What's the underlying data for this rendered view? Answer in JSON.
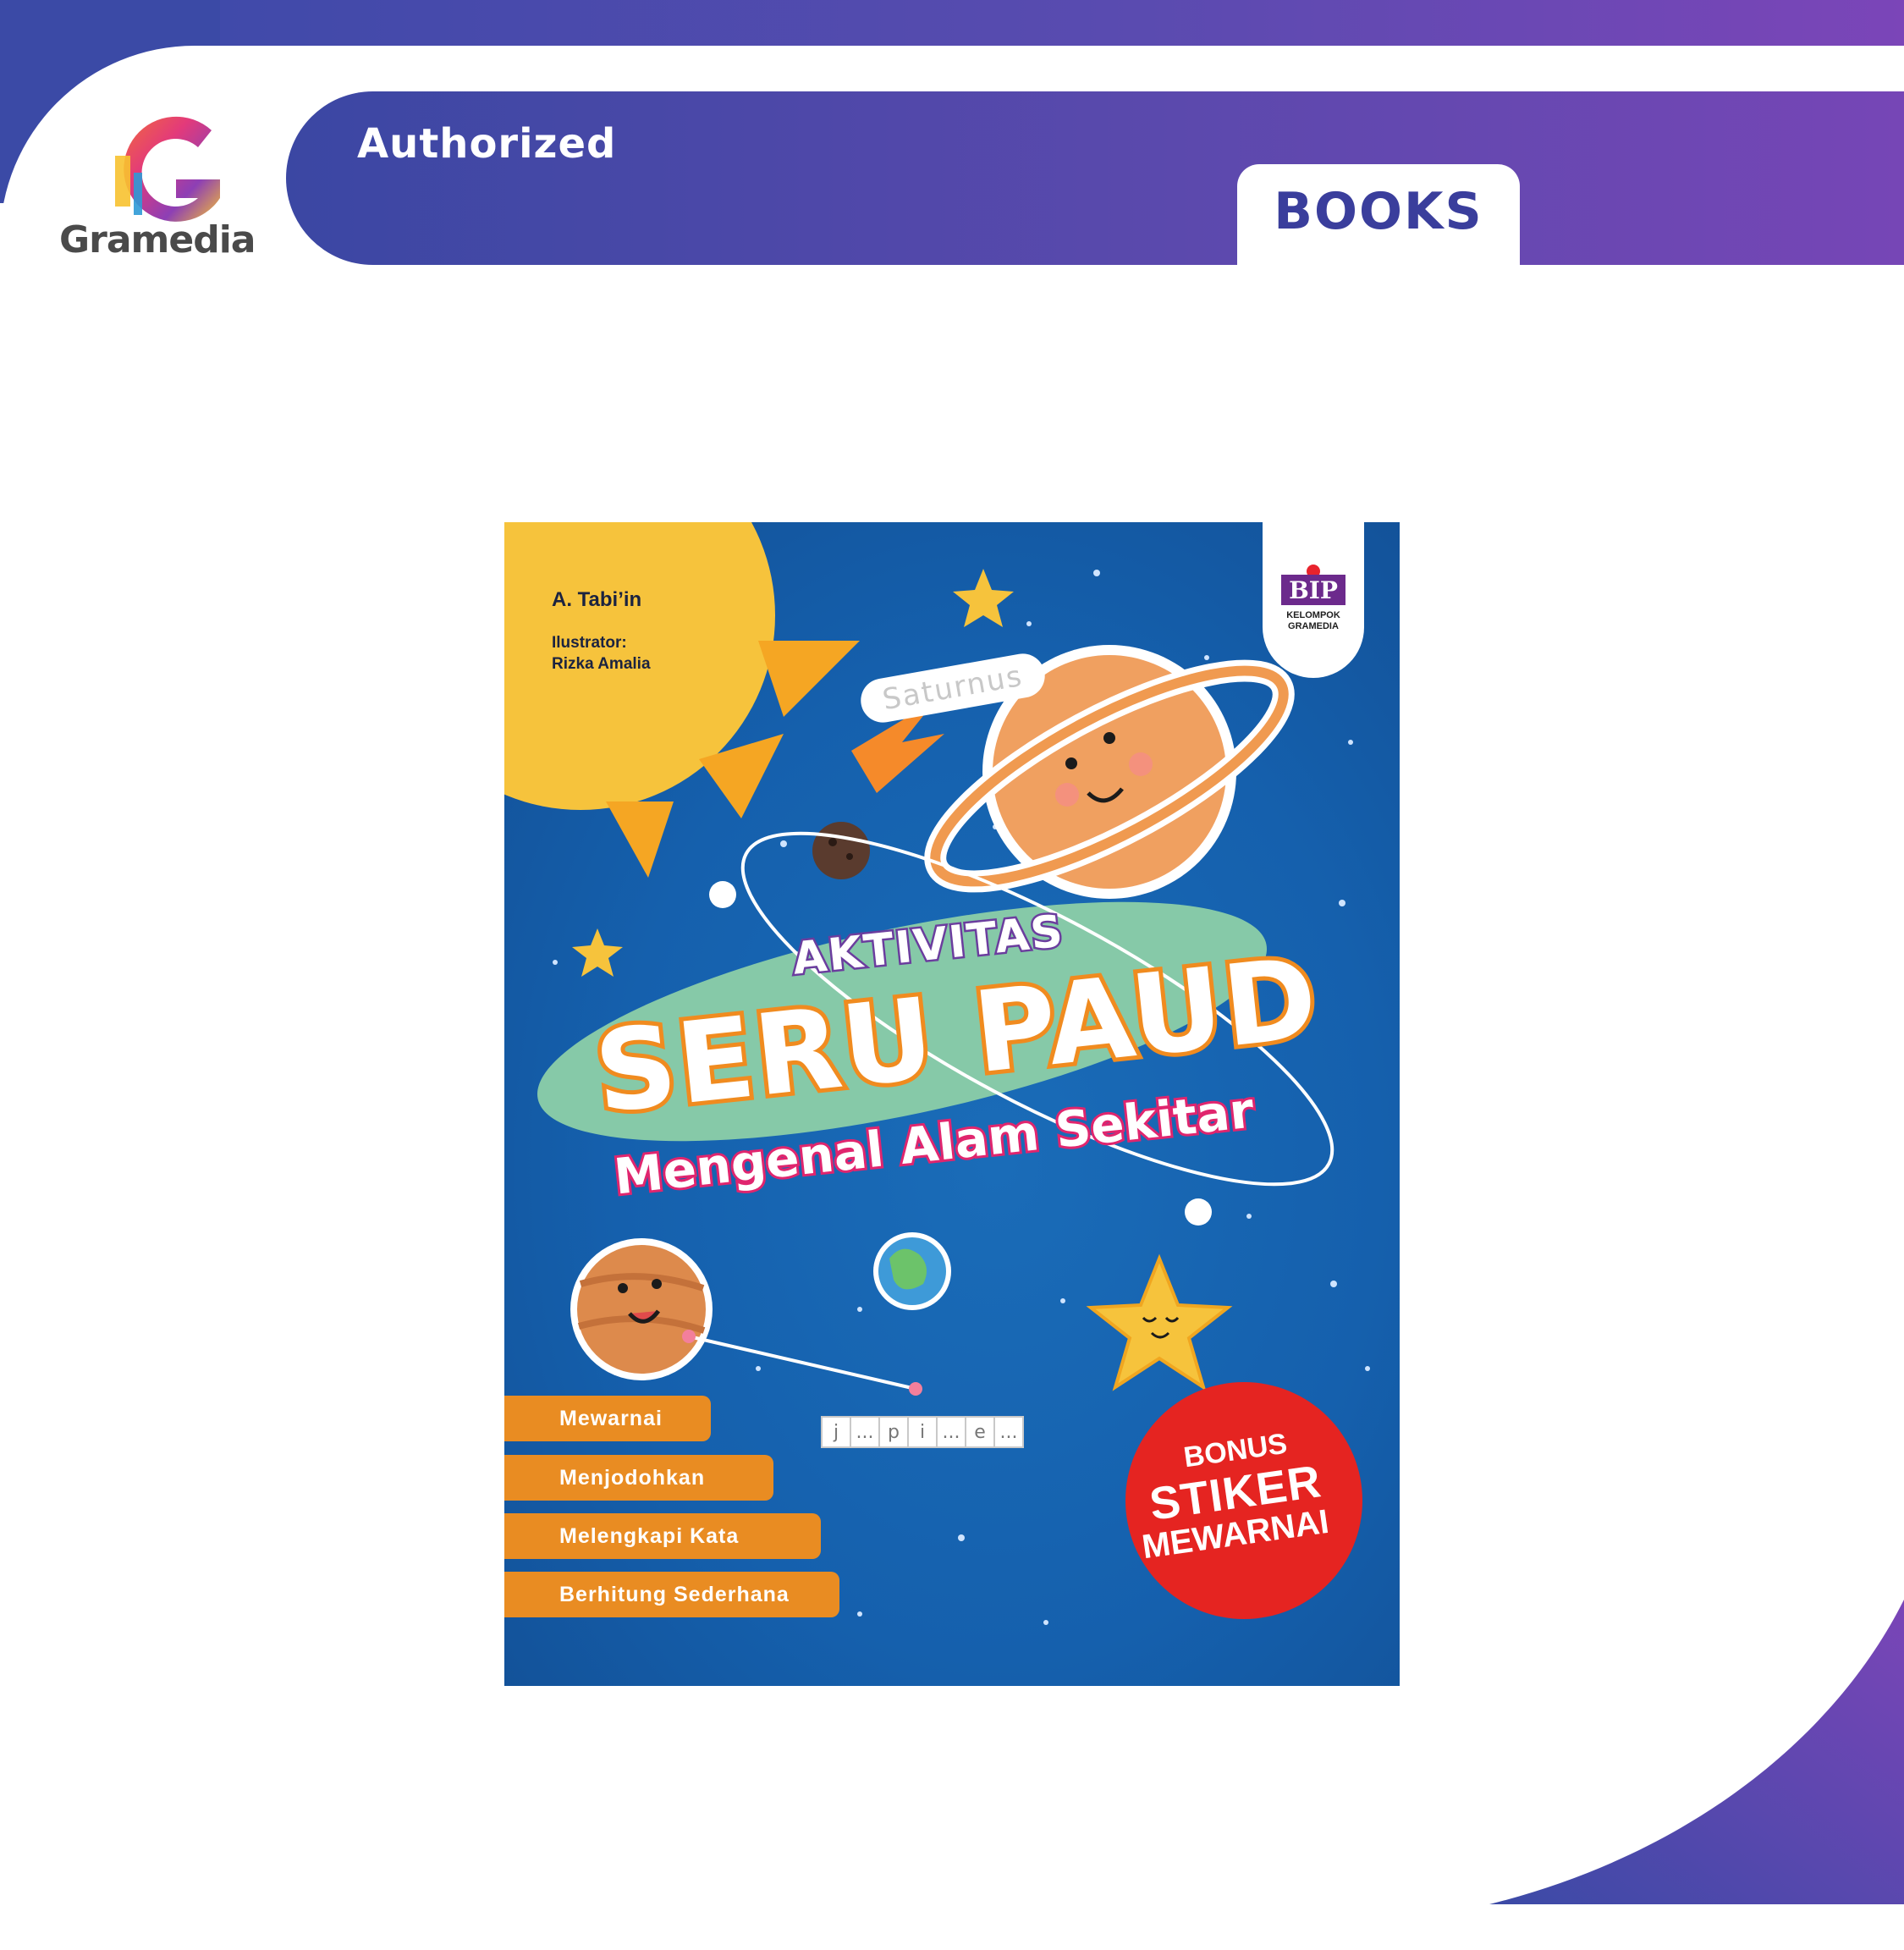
{
  "brand": {
    "name": "Gramedia",
    "badge": "Authorized",
    "category": "BOOKS"
  },
  "colors": {
    "primary": "#3b47a3",
    "secondary": "#7646b6",
    "cover_bg": "#1560ad",
    "accent_orange": "#e98c22",
    "bonus_red": "#e52421"
  },
  "cover": {
    "author": "A. Tabi’in",
    "illustrator_label": "Ilustrator:",
    "illustrator_name": "Rizka Amalia",
    "saturn_label": "Saturnus",
    "title_line1": "AKTIVITAS",
    "title_line2": "SERU PAUD",
    "subtitle": "Mengenal Alam Sekitar",
    "publisher": {
      "logo": "BIP",
      "line1": "KELOMPOK",
      "line2": "GRAMEDIA"
    },
    "activities": [
      "Mewarnai",
      "Menjodohkan",
      "Melengkapi Kata",
      "Berhitung Sederhana"
    ],
    "word_puzzle": [
      "j",
      "...",
      "p",
      "i",
      "...",
      "e",
      "..."
    ],
    "bonus": {
      "line1": "BONUS",
      "line2": "STIKER",
      "line3": "MEWARNAI"
    }
  }
}
